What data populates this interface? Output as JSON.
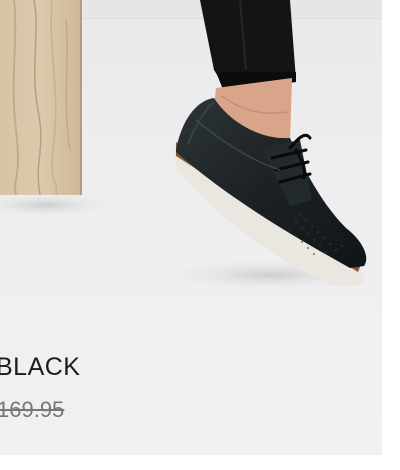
{
  "product": {
    "name": "BLACK",
    "price": "169.95",
    "image_icon": "shoe-product-photo"
  },
  "colors": {
    "name_text": "#1c1c1c",
    "price_text": "#777777",
    "background": "#eeeef0"
  }
}
